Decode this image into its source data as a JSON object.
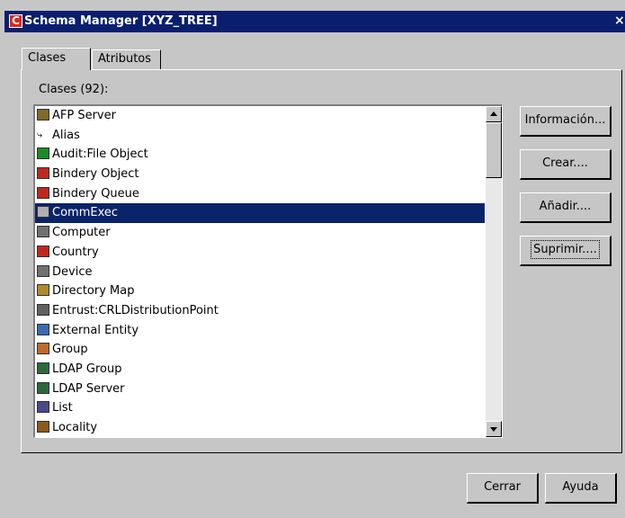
{
  "window": {
    "title": "Schema Manager [XYZ_TREE]",
    "close_label": "×",
    "colors": {
      "titlebar": "#0a1e6e",
      "selection": "#0a246a",
      "app_icon": "#d8281e"
    }
  },
  "tabs": [
    {
      "label": "Clases",
      "active": true
    },
    {
      "label": "Atributos",
      "active": false
    }
  ],
  "group_label": "Clases (92):",
  "classes": [
    {
      "label": "AFP Server",
      "icon": "afp-server-icon",
      "color": "#7f6a2a"
    },
    {
      "label": "Alias",
      "icon": "alias-arrow-icon",
      "color": "#000000"
    },
    {
      "label": "Audit:File Object",
      "icon": "audit-file-icon",
      "color": "#1c8a2a"
    },
    {
      "label": "Bindery Object",
      "icon": "bindery-object-icon",
      "color": "#c0281e"
    },
    {
      "label": "Bindery Queue",
      "icon": "bindery-queue-icon",
      "color": "#c0281e"
    },
    {
      "label": "CommExec",
      "icon": "commexec-icon",
      "color": "#b0b0b0",
      "selected": true
    },
    {
      "label": "Computer",
      "icon": "computer-icon",
      "color": "#707070"
    },
    {
      "label": "Country",
      "icon": "country-flag-icon",
      "color": "#c0281e"
    },
    {
      "label": "Device",
      "icon": "device-icon",
      "color": "#707070"
    },
    {
      "label": "Directory Map",
      "icon": "directory-map-icon",
      "color": "#b08a2a"
    },
    {
      "label": "Entrust:CRLDistributionPoint",
      "icon": "entrust-crl-icon",
      "color": "#606060"
    },
    {
      "label": "External Entity",
      "icon": "external-entity-icon",
      "color": "#3a6ab0"
    },
    {
      "label": "Group",
      "icon": "group-icon",
      "color": "#c06a2a"
    },
    {
      "label": "LDAP Group",
      "icon": "ldap-group-icon",
      "color": "#2a6a3a"
    },
    {
      "label": "LDAP Server",
      "icon": "ldap-server-icon",
      "color": "#2a6a3a"
    },
    {
      "label": "List",
      "icon": "list-icon",
      "color": "#4a4a8a"
    },
    {
      "label": "Locality",
      "icon": "locality-icon",
      "color": "#8a5a1a"
    }
  ],
  "side_buttons": {
    "info": "Información...",
    "create": "Crear....",
    "add": "Añadir....",
    "delete": "Suprimir...."
  },
  "bottom_buttons": {
    "close": "Cerrar",
    "help": "Ayuda"
  }
}
